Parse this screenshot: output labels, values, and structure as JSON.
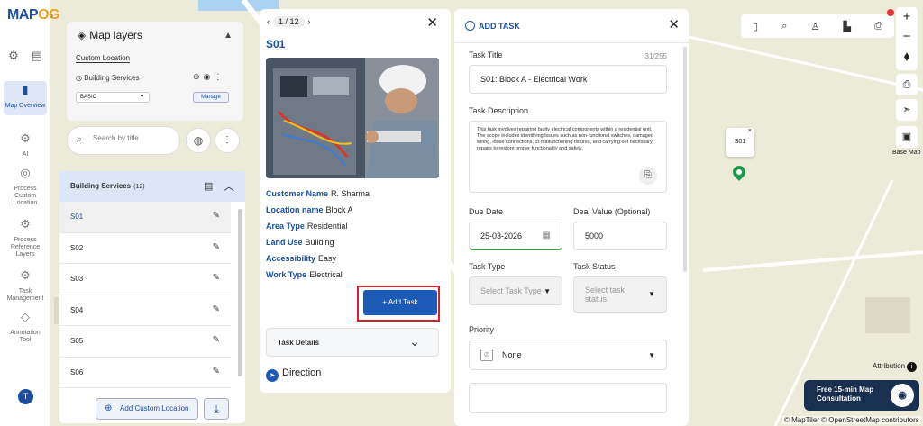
{
  "app": {
    "logo_left": "MAP",
    "logo_right": "OG"
  },
  "rail": {
    "items": [
      {
        "label": "Map Overview",
        "icon": "map-icon"
      },
      {
        "label": "AI",
        "icon": "ai-icon"
      },
      {
        "label": "Process Custom Location",
        "icon": "location-icon"
      },
      {
        "label": "Process Reference Layers",
        "icon": "layers-icon"
      },
      {
        "label": "Task Management",
        "icon": "task-icon"
      },
      {
        "label": "Annotation Tool",
        "icon": "annotation-icon"
      }
    ],
    "avatar": "T"
  },
  "layers": {
    "title": "Map layers",
    "custom_location": "Custom Location",
    "building_services": "Building Services",
    "basic_select": "BASIC",
    "manage": "Manage"
  },
  "search": {
    "placeholder": "Search by title"
  },
  "list": {
    "header": "Building Services",
    "count": "(12)",
    "items": [
      "S01",
      "S02",
      "S03",
      "S04",
      "S05",
      "S06"
    ]
  },
  "bottom_actions": {
    "add_custom": "Add Custom Location"
  },
  "detail": {
    "pager": "1 / 12",
    "code": "S01",
    "fields": [
      {
        "label": "Customer Name",
        "value": "R. Sharma"
      },
      {
        "label": "Location name",
        "value": "Block A"
      },
      {
        "label": "Area Type",
        "value": "Residential"
      },
      {
        "label": "Land Use",
        "value": "Building"
      },
      {
        "label": "Accessibility",
        "value": "Easy"
      },
      {
        "label": "Work Type",
        "value": "Electrical"
      }
    ],
    "add_task": "+ Add Task",
    "task_details": "Task Details",
    "direction": "Direction"
  },
  "form": {
    "title": "ADD TASK",
    "task_title_label": "Task Title",
    "task_title_count": "31/255",
    "task_title_value": "S01: Block A - Electrical Work",
    "description_label": "Task Description",
    "description_value": "This task involves repairing faulty electrical components within a residential unit. The scope includes identifying issues such as non-functional switches, damaged wiring, loose connections, or malfunctioning fixtures, and carrying out necessary repairs to restore proper functionality and safety.",
    "due_date_label": "Due Date",
    "due_date_value": "25-03-2026",
    "deal_value_label": "Deal Value (Optional)",
    "deal_value_value": "5000",
    "task_type_label": "Task Type",
    "task_type_placeholder": "Select Task Type",
    "task_status_label": "Task Status",
    "task_status_placeholder": "Select task status",
    "priority_label": "Priority",
    "priority_value": "None"
  },
  "map": {
    "marker_label": "S01",
    "basemap_label": "Base Map",
    "attribution": "Attribution",
    "consult": "Free 15-min Map Consultation",
    "credits": "© MapTiler © OpenStreetMap contributors",
    "marker_color": "#1e9a4a"
  },
  "colors": {
    "brand": "#1c4f9c",
    "highlight": "#d8202a"
  }
}
